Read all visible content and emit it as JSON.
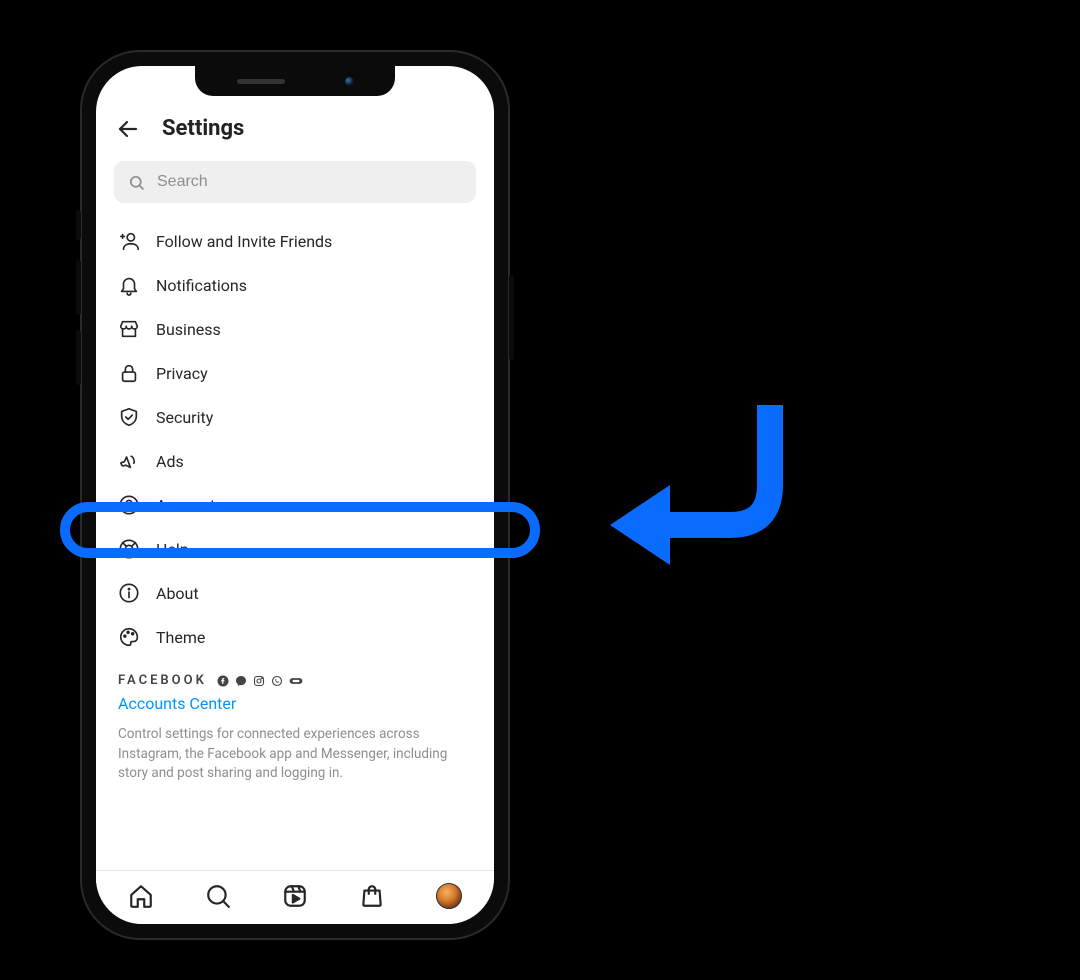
{
  "header": {
    "title": "Settings"
  },
  "search": {
    "placeholder": "Search"
  },
  "menu": {
    "items": [
      {
        "label": "Follow and Invite Friends"
      },
      {
        "label": "Notifications"
      },
      {
        "label": "Business"
      },
      {
        "label": "Privacy"
      },
      {
        "label": "Security"
      },
      {
        "label": "Ads"
      },
      {
        "label": "Account"
      },
      {
        "label": "Help"
      },
      {
        "label": "About"
      },
      {
        "label": "Theme"
      }
    ]
  },
  "footer": {
    "section_brand": "FACEBOOK",
    "accounts_center": "Accounts Center",
    "description": "Control settings for connected experiences across Instagram, the Facebook app and Messenger, including story and post sharing and logging in."
  }
}
